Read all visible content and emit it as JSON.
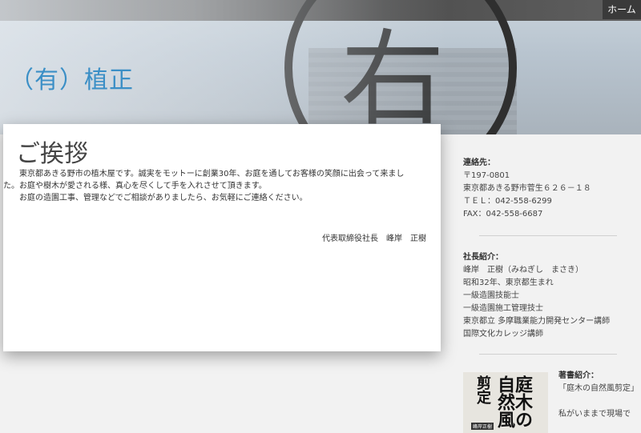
{
  "header": {
    "home_label": "ホーム",
    "site_title": "（有）植正"
  },
  "greeting": {
    "title": "ご挨拶",
    "paragraphs": [
      "東京都あきる野市の植木屋です。誠実をモットーに創業30年、お庭を通してお客様の笑顔に出会って来まし",
      "た。お庭や樹木が愛される様、真心を尽くして手を入れさせて頂きます。",
      "お庭の造園工事、管理などでご相談がありましたら、お気軽にご連絡ください。"
    ],
    "signature": "代表取締役社長　峰岸　正樹"
  },
  "contact": {
    "heading": "連絡先：",
    "postal": "〒197-0801",
    "address": "東京都あきる野市菅生６２６－１８",
    "tel": "ＴＥＬ：042-558-6299",
    "fax": "FAX：042-558-6687"
  },
  "president": {
    "heading": "社長紹介：",
    "lines": [
      "峰岸　正樹（みねぎし　まさき）",
      "昭和32年、東京都生まれ",
      "一級造園技能士",
      "一級造園施工管理技士",
      "東京都立 多摩職業能力開発センター講師",
      "国際文化カレッジ講師"
    ]
  },
  "writings": {
    "heading": "著書紹介：",
    "book_title": "「庭木の自然風剪定」",
    "book_cover_text_1": "庭木の",
    "book_cover_text_2": "自然風",
    "book_cover_text_3": "剪定",
    "book_cover_author": "峰岸正樹",
    "teaser": "私がいままで現場で"
  }
}
